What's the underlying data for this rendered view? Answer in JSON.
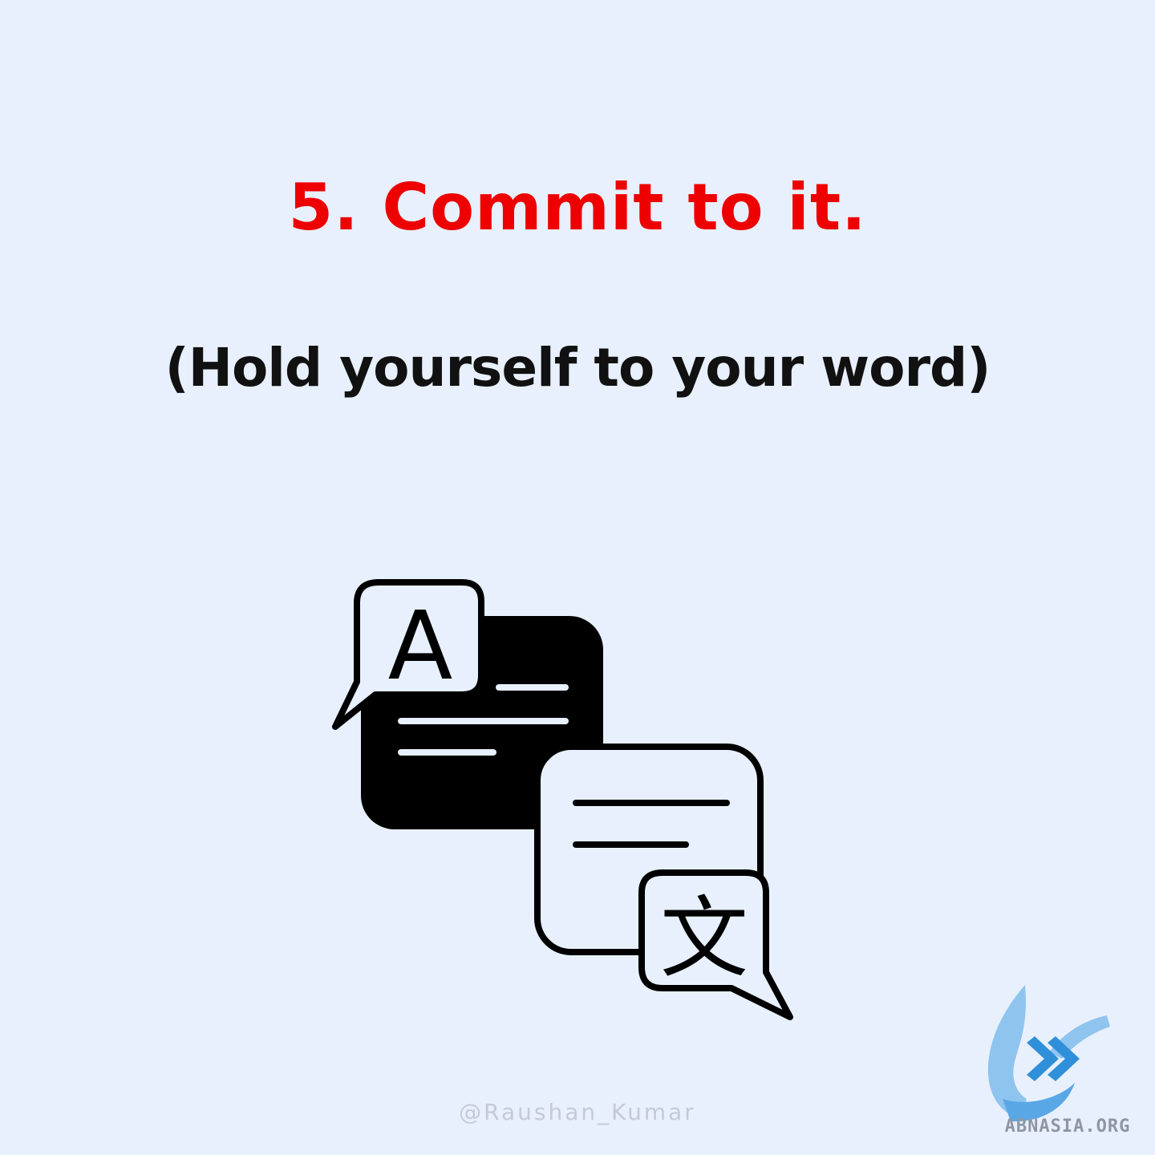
{
  "heading": {
    "text": "5. Commit to it.",
    "color": "#ee0000"
  },
  "subheading": {
    "text": "(Hold yourself to your word)"
  },
  "illustration": {
    "icon": "translate-chat-icon",
    "glyph_latin": "A",
    "glyph_cjk": "文"
  },
  "footer": {
    "handle": "@Raushan_Kumar"
  },
  "watermark": {
    "text": "ABNASIA.ORG",
    "color": "#5aa7e6"
  }
}
